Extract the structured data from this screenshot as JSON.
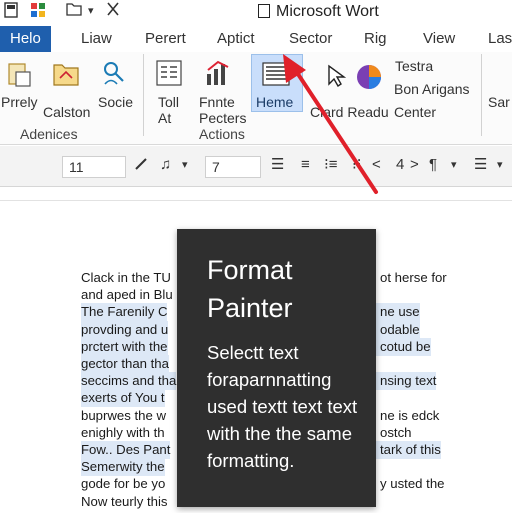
{
  "title_bar": {
    "title": "Microsoft Wort",
    "quick_access_icons": [
      "save-icon",
      "grid-icon",
      "folder-icon",
      "dropdown-icon",
      "undo-icon"
    ]
  },
  "tabs": [
    "Helo",
    "Liaw",
    "Perert",
    "Aptict",
    "Sector",
    "Rig",
    "View",
    "Las"
  ],
  "active_tab": "Helo",
  "ribbon": {
    "prrely": "Prrely",
    "calston": "Calston",
    "socie": "Socie",
    "group_adenices": "Adenices",
    "toll_at_1": "Toll",
    "toll_at_2": "At",
    "fnnte_1": "Fnnte",
    "fnnte_2": "Pecters",
    "group_actions": "Actions",
    "heme": "Heme",
    "ciard_readu": "Ciard Readu",
    "testra": "Testra",
    "bon_arigans": "Bon Arigans",
    "center": "Center",
    "sar": "Sar"
  },
  "toolbar": {
    "font_size": "11",
    "size_2": "7",
    "number_4": "4"
  },
  "document": {
    "lines": [
      {
        "text": "Clack in the TU",
        "tail": "ot herse for",
        "hl": false
      },
      {
        "text": "and aped in Blu",
        "tail": "",
        "hl": false
      },
      {
        "text": "The Farenily C",
        "tail": "ne use",
        "hl": true
      },
      {
        "text": "provding and u",
        "tail": "odable",
        "hl": true
      },
      {
        "text": "prctert with the",
        "tail": "cotud be",
        "hl": true
      },
      {
        "text": "gector than tha",
        "tail": "",
        "hl": true
      },
      {
        "text": "seccims and tha",
        "tail": "nsing text",
        "hl": true
      },
      {
        "text": "exerts of You t",
        "tail": "",
        "hl": true
      },
      {
        "text": "buprwes the w",
        "tail": "ne is edck",
        "hl": false
      },
      {
        "text": "enighly with th",
        "tail": "ostch",
        "hl": false
      },
      {
        "text": "Fow.. Des Pant",
        "tail": "tark of this",
        "hl": true
      },
      {
        "text": "Semerwity the",
        "tail": "",
        "hl": true
      },
      {
        "text": "gode for be yo",
        "tail": "y usted the",
        "hl": false
      },
      {
        "text": "Now teurly this",
        "tail": "",
        "hl": false
      }
    ]
  },
  "tooltip": {
    "title": "Format Painter",
    "body": "Selectt text foraparnnatting used textt text text with the the same formatting."
  },
  "colors": {
    "active_tab": "#1f5fad",
    "tooltip_bg": "#2f2f2f",
    "arrow": "#e0202a",
    "selection": "#dde8f6"
  }
}
